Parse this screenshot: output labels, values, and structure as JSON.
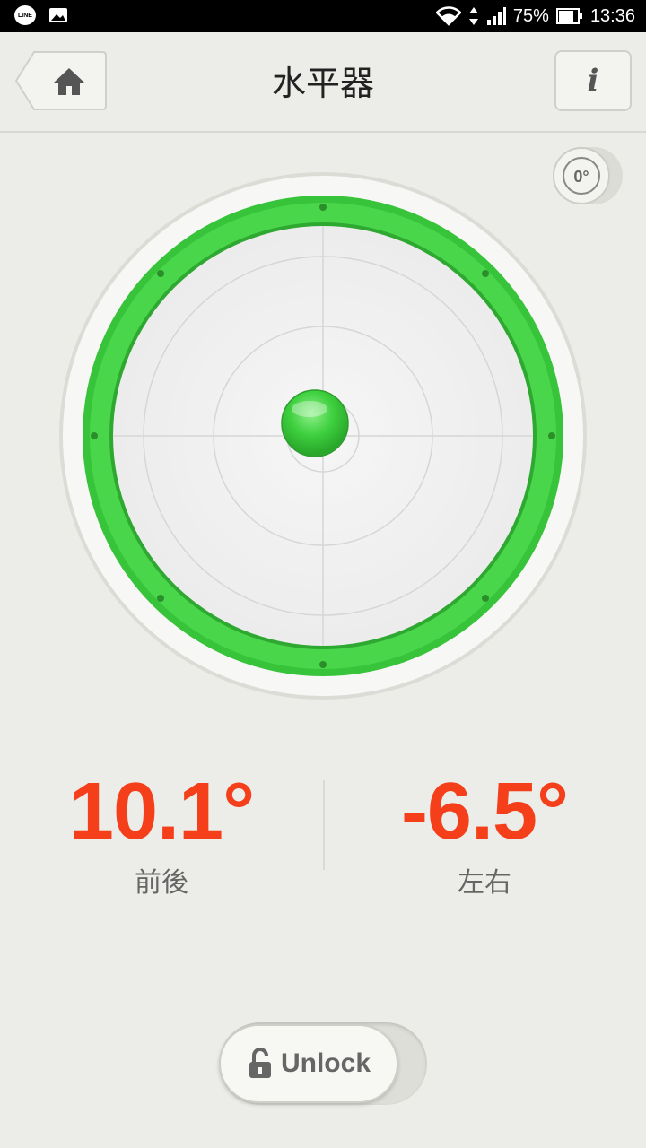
{
  "status_bar": {
    "battery_percent": "75%",
    "time": "13:36",
    "line_label": "LINE"
  },
  "header": {
    "title": "水平器",
    "info_label": "i"
  },
  "calibrate": {
    "label": "0°"
  },
  "level": {
    "ring_color": "#39c63a",
    "bubble_color": "#3ed03e"
  },
  "readouts": {
    "front_back": {
      "value": "10.1°",
      "label": "前後"
    },
    "left_right": {
      "value": "-6.5°",
      "label": "左右"
    }
  },
  "lock_toggle": {
    "label": "Unlock",
    "icon": "unlocked-padlock-icon"
  },
  "colors": {
    "accent": "#f43f1a",
    "background": "#ecece8"
  }
}
